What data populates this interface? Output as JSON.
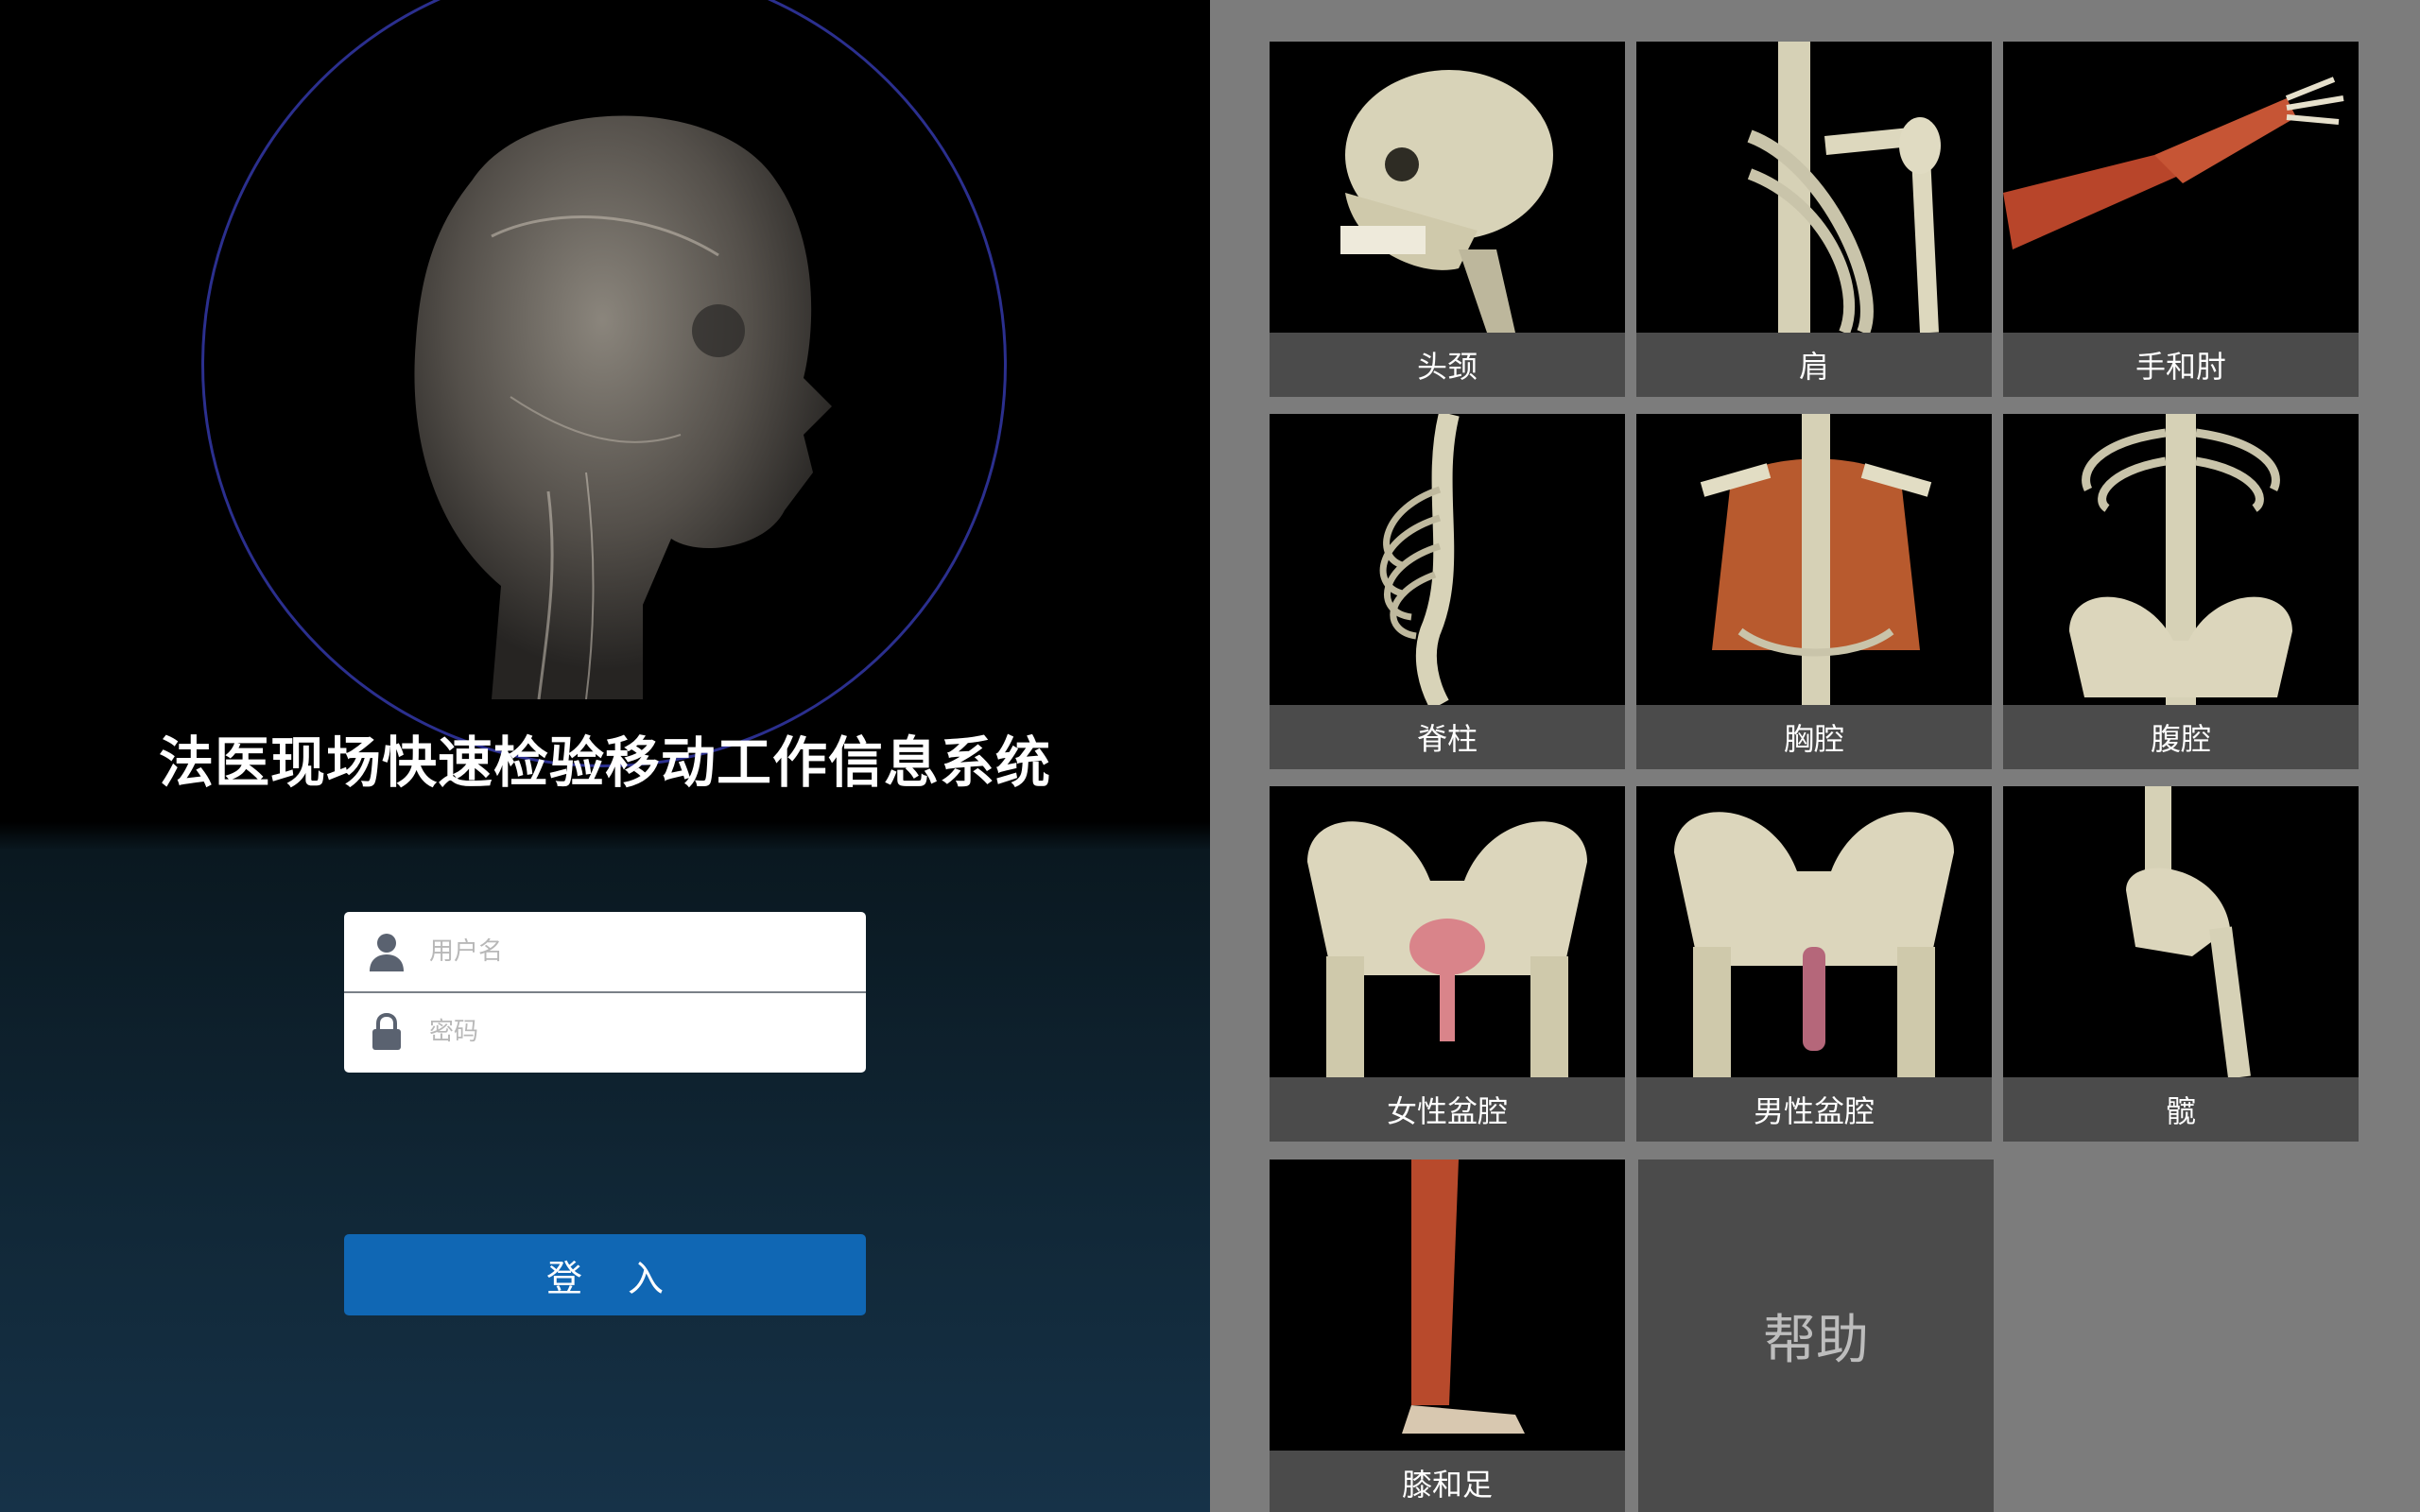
{
  "app": {
    "title": "法医现场快速检验移动工作信息系统"
  },
  "login": {
    "username_placeholder": "用户名",
    "password_placeholder": "密码",
    "submit_label": "登 入"
  },
  "tiles": [
    {
      "label": "头颈"
    },
    {
      "label": "肩"
    },
    {
      "label": "手和肘"
    },
    {
      "label": "脊柱"
    },
    {
      "label": "胸腔"
    },
    {
      "label": "腹腔"
    },
    {
      "label": "女性盆腔"
    },
    {
      "label": "男性盆腔"
    },
    {
      "label": "髋"
    },
    {
      "label": "膝和足"
    }
  ],
  "help": {
    "label": "帮助"
  },
  "colors": {
    "accent_button": "#1067b4",
    "ring": "#2b2f8e",
    "tile_label_bg": "#4b4b4b",
    "panel_bg": "#7c7c7c"
  },
  "icons": {
    "username": "user-icon",
    "password": "lock-icon"
  }
}
